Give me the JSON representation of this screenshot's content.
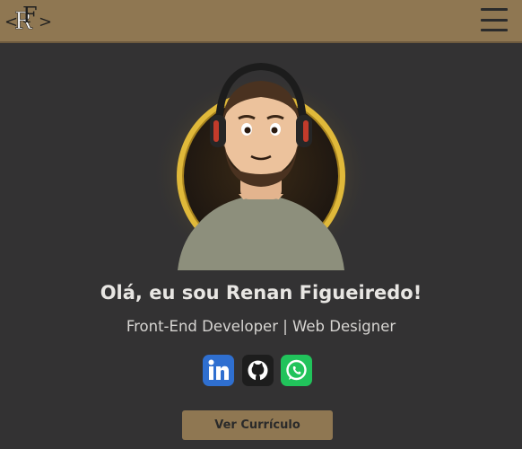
{
  "header": {
    "logo_text": "<RF>",
    "menu_icon": "hamburger-menu-icon"
  },
  "hero": {
    "greeting": "Olá, eu sou Renan Figueiredo!",
    "subtitle": "Front-End Developer | Web Designer",
    "avatar_icon": "cartoon-avatar-with-headphones",
    "socials": [
      {
        "name": "LinkedIn",
        "icon": "linkedin-icon",
        "color": "#2f6fd0"
      },
      {
        "name": "GitHub",
        "icon": "github-icon",
        "color": "#1d1d1d"
      },
      {
        "name": "WhatsApp",
        "icon": "whatsapp-icon",
        "color": "#21c35b"
      }
    ],
    "cv_button": "Ver Currículo"
  },
  "colors": {
    "header_bg": "#8f7752",
    "page_bg": "#333233",
    "gold_ring": "#e0b93a",
    "button_bg": "#8f7752"
  }
}
